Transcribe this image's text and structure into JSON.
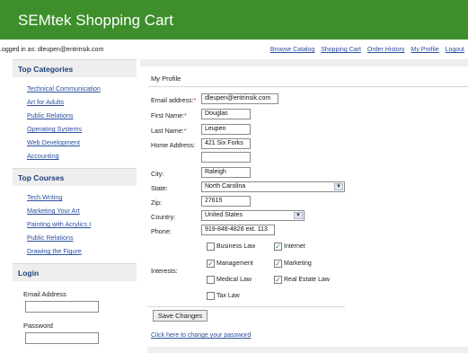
{
  "app": {
    "title": "SEMtek Shopping Cart"
  },
  "user_bar": {
    "logged_in_text": ".ogged in as: dleupen@entrinsik.com",
    "nav": [
      "Browse Catalog",
      "Shopping Cart",
      "Order History",
      "My Profile",
      "Logout"
    ]
  },
  "sidebar": {
    "categories_heading": "Top Categories",
    "categories": [
      "Technical Communication",
      "Art for Adults",
      "Public Relations",
      "Operating Systems",
      "Web Development",
      "Accounting"
    ],
    "courses_heading": "Top Courses",
    "courses": [
      "Tech Writing",
      "Marketing Your Art",
      "Painting with Acrylics I",
      "Public Relations",
      "Drawing the Figure"
    ],
    "login_heading": "Login",
    "email_label": "Email Address",
    "password_label": "Password"
  },
  "profile": {
    "heading": "My Profile",
    "email_label": "Email address:",
    "email_value": "dleupen@entrinsik.com",
    "first_name_label": "First Name:",
    "first_name_value": "Douglas",
    "last_name_label": "Last Name:",
    "last_name_value": "Leupen",
    "address_label": "Home Address:",
    "address_line1": "421 Six Forks",
    "address_line2": "",
    "city_label": "City:",
    "city_value": "Raleigh",
    "state_label": "State:",
    "state_value": "North Carolina",
    "zip_label": "Zip:",
    "zip_value": "27615",
    "country_label": "Country:",
    "country_value": "United States",
    "phone_label": "Phone:",
    "phone_value": "919-848-4828 ext. 113",
    "interests_label": "Interests:",
    "interests": [
      {
        "label": "Business Law",
        "checked": false
      },
      {
        "label": "Internet",
        "checked": true
      },
      {
        "label": "Management",
        "checked": true
      },
      {
        "label": "Marketing",
        "checked": true
      },
      {
        "label": "Medical Law",
        "checked": false
      },
      {
        "label": "Real Estate Law",
        "checked": true
      },
      {
        "label": "Tax Law",
        "checked": false
      }
    ],
    "save_label": "Save Changes",
    "change_password_link": "Click here to change your password"
  },
  "icons": {
    "dropdown": "chevron-down-icon",
    "check": "checkmark-icon"
  },
  "colors": {
    "header_bg": "#3e8f2c",
    "link": "#2a4f9e",
    "required": "#d02020"
  }
}
